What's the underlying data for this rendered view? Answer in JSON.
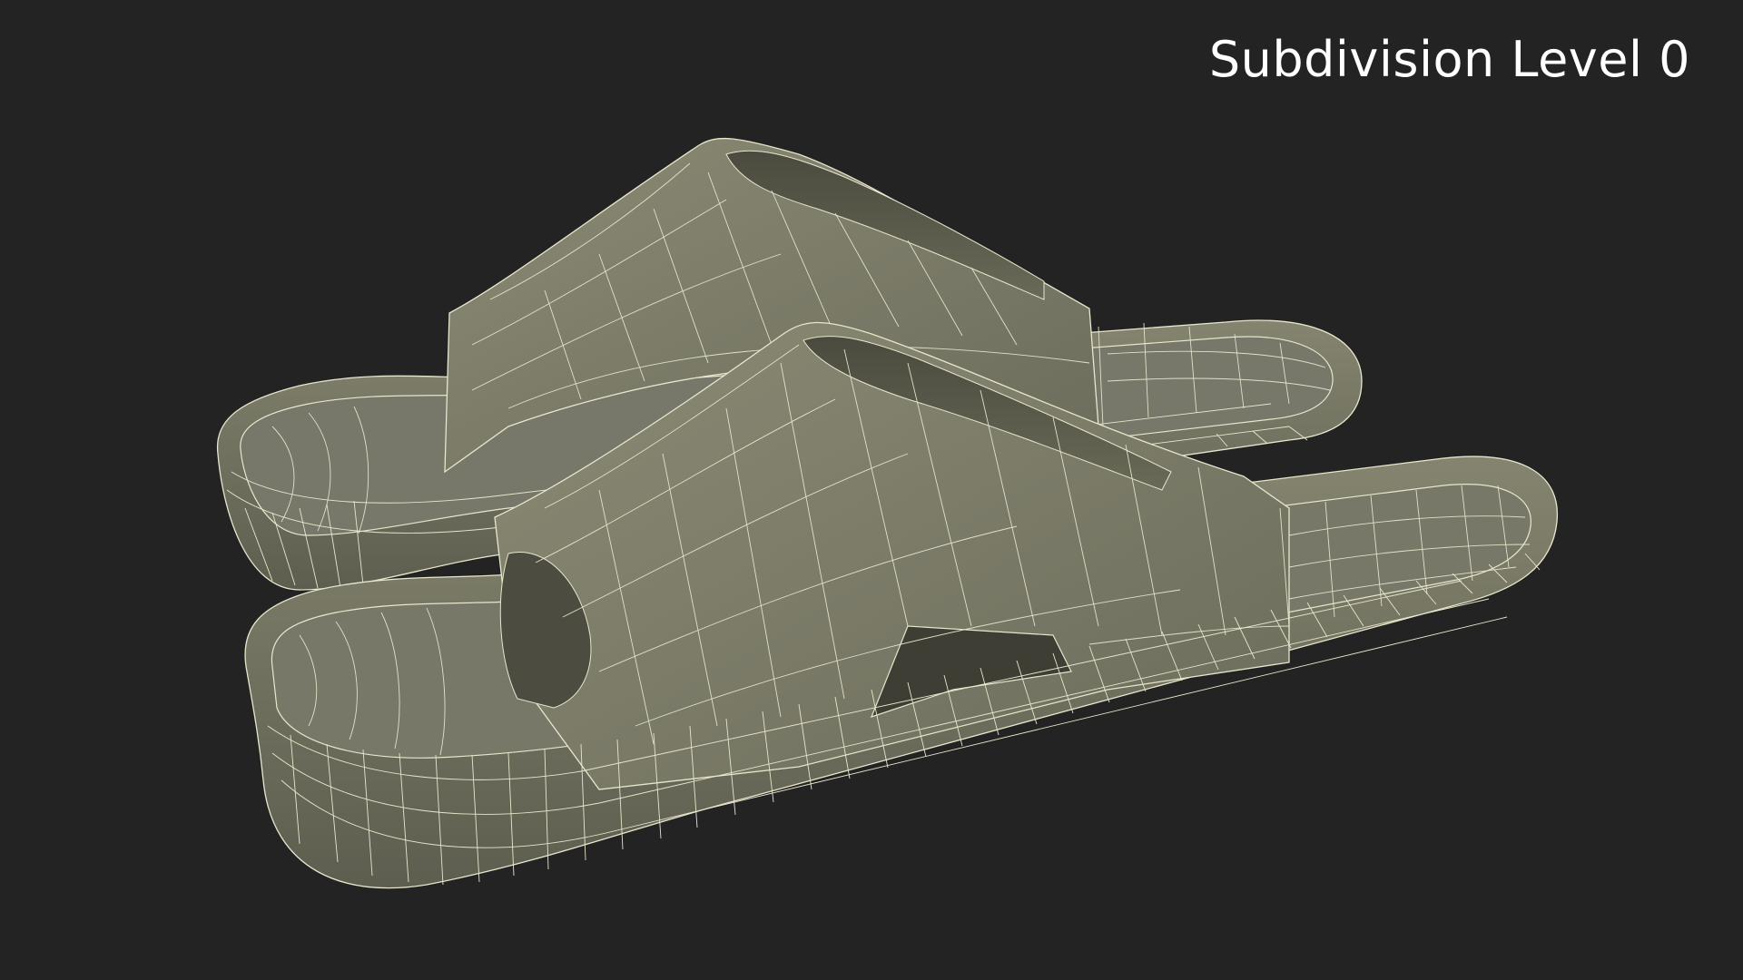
{
  "viewport": {
    "label": "Subdivision Level 0",
    "background": "#232323"
  },
  "model": {
    "subject": "pair of slide sandals",
    "display_mode": "wireframe-on-shaded",
    "surface_color": "#7a7a68",
    "wire_color": "#e8e6cc"
  }
}
